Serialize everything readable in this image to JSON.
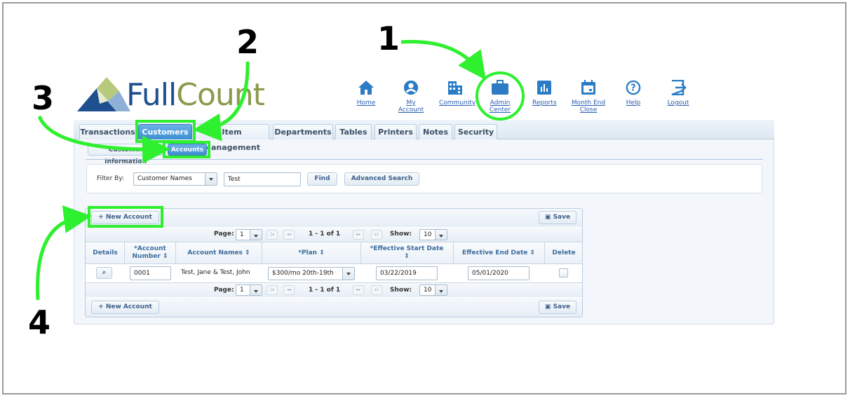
{
  "logo": {
    "part1": "Full",
    "part2": "Count"
  },
  "nav": [
    {
      "label": "Home",
      "icon": "home-icon"
    },
    {
      "label": "My Account",
      "icon": "user-circle-icon"
    },
    {
      "label": "Community",
      "icon": "building-icon"
    },
    {
      "label": "Admin Center",
      "icon": "briefcase-icon"
    },
    {
      "label": "Reports",
      "icon": "bar-chart-icon"
    },
    {
      "label": "Month End",
      "label2": "Close",
      "icon": "calendar-icon"
    },
    {
      "label": "Help",
      "icon": "help-circle-icon"
    },
    {
      "label": "Logout",
      "icon": "logout-icon"
    }
  ],
  "tabs": [
    "Transactions",
    "Customers",
    "Item Management",
    "Departments",
    "Tables",
    "Printers",
    "Notes",
    "Security"
  ],
  "active_tab": "Customers",
  "subtabs": [
    "Customer Information",
    "Accounts"
  ],
  "active_subtab": "Accounts",
  "filter": {
    "label": "Filter By:",
    "select_value": "Customer Names",
    "text_value": "Test",
    "find_label": "Find",
    "advanced_label": "Advanced Search"
  },
  "grid": {
    "new_account_label": "New Account",
    "save_label": "Save",
    "pager": {
      "page_label": "Page:",
      "page_value": "1",
      "range_text": "1 - 1 of 1",
      "show_label": "Show:",
      "show_value": "10"
    },
    "columns": [
      "Details",
      "*Account Number",
      "Account Names",
      "*Plan",
      "*Effective Start Date",
      "Effective End Date",
      "Delete"
    ],
    "rows": [
      {
        "account_number": "0001",
        "account_names": "Test, Jane & Test, John",
        "plan": "$300/mo 20th-19th",
        "start_date": "03/22/2019",
        "end_date": "05/01/2020",
        "delete": false
      }
    ]
  },
  "annotations": [
    "1",
    "2",
    "3",
    "4"
  ],
  "colors": {
    "highlight": "#2ef02e",
    "accent": "#3d8fd2",
    "logo_blue": "#1f4f8f",
    "logo_green": "#8a9a4a"
  }
}
